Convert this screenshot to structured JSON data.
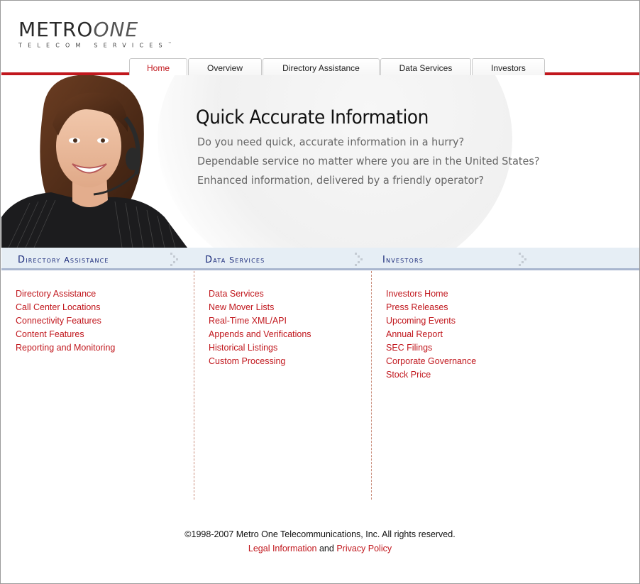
{
  "logo": {
    "metro": "METRO",
    "one": "ONE",
    "tagline": "TELECOM SERVICES",
    "tm": "™"
  },
  "tabs": [
    {
      "label": "Home",
      "active": true
    },
    {
      "label": "Overview",
      "active": false
    },
    {
      "label": "Directory Assistance",
      "active": false
    },
    {
      "label": "Data Services",
      "active": false
    },
    {
      "label": "Investors",
      "active": false
    }
  ],
  "hero": {
    "title": "Quick Accurate Information",
    "lines": [
      "Do you need quick, accurate information in a hurry?",
      "Dependable service no matter where you are in the United States?",
      "Enhanced information, delivered by a friendly operator?"
    ]
  },
  "sections": [
    {
      "title": "Directory Assistance",
      "links": [
        "Directory Assistance",
        "Call Center Locations",
        "Connectivity Features",
        "Content Features",
        "Reporting and Monitoring"
      ]
    },
    {
      "title": "Data Services",
      "links": [
        "Data Services",
        "New Mover Lists",
        "Real-Time XML/API",
        "Appends and Verifications",
        "Historical Listings",
        "Custom Processing"
      ]
    },
    {
      "title": "Investors",
      "links": [
        "Investors Home",
        "Press Releases",
        "Upcoming Events",
        "Annual Report",
        "SEC Filings",
        "Corporate Governance",
        "Stock Price"
      ]
    }
  ],
  "footer": {
    "copyright": "©1998-2007 Metro One Telecommunications, Inc. All rights reserved.",
    "legal_link": "Legal Information",
    "and": "and",
    "privacy_link": "Privacy Policy"
  },
  "colors": {
    "accent": "#c1171d",
    "section_bg": "#e6eef5",
    "section_text": "#1a2a7a"
  }
}
